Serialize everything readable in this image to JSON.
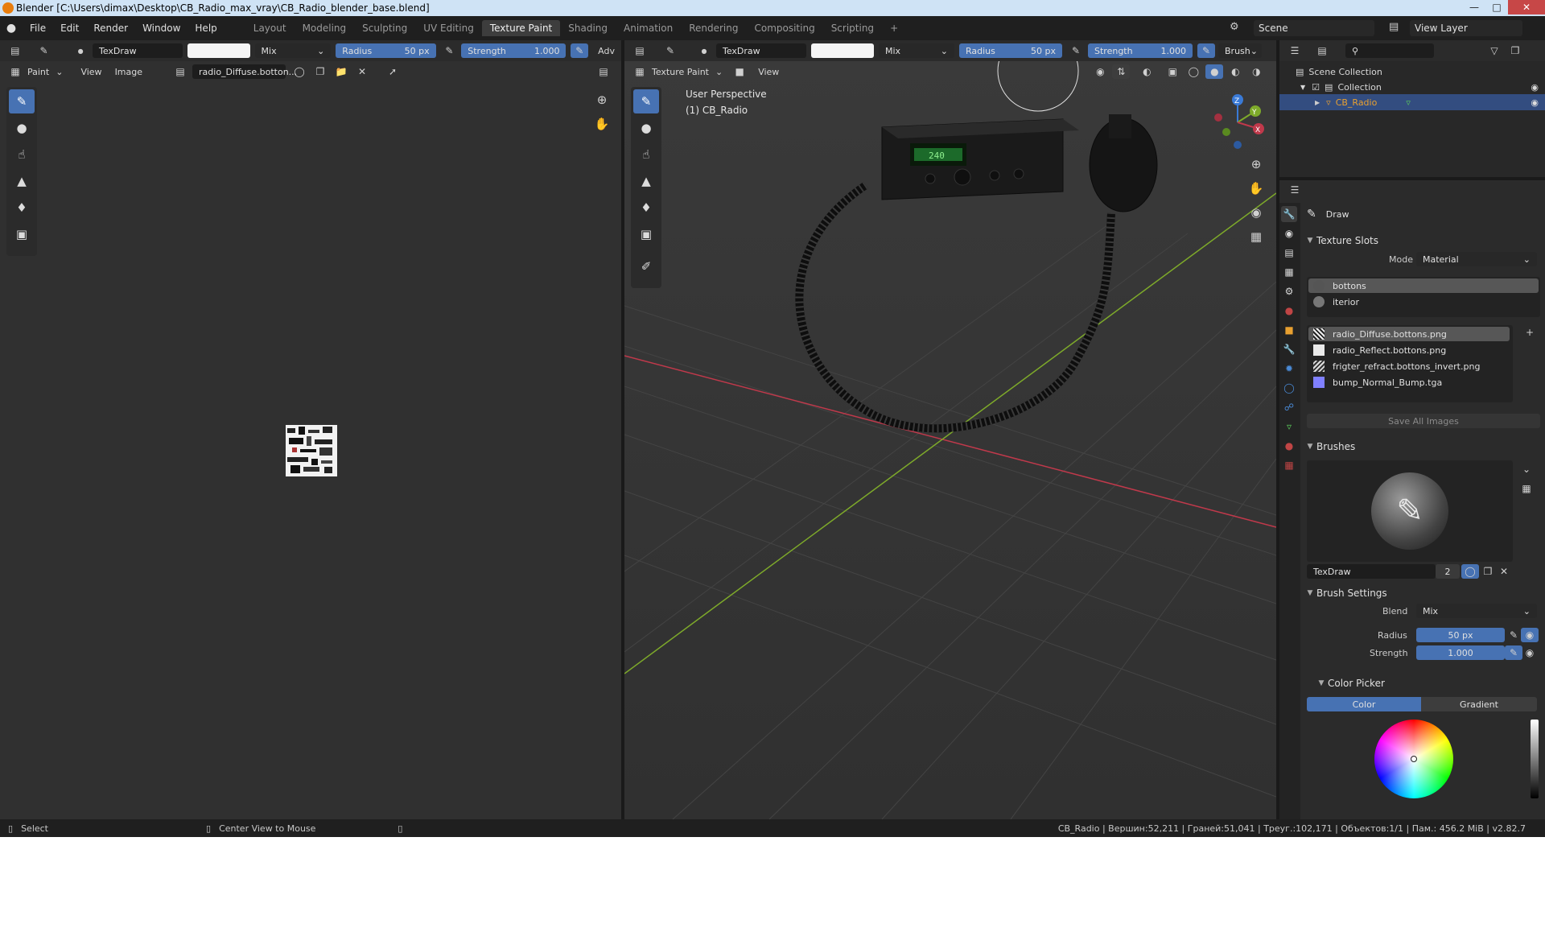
{
  "window": {
    "title": "Blender [C:\\Users\\dimax\\Desktop\\CB_Radio_max_vray\\CB_Radio_blender_base.blend]"
  },
  "menu": [
    "File",
    "Edit",
    "Render",
    "Window",
    "Help"
  ],
  "workspaces": [
    "Layout",
    "Modeling",
    "Sculpting",
    "UV Editing",
    "Texture Paint",
    "Shading",
    "Animation",
    "Rendering",
    "Compositing",
    "Scripting"
  ],
  "workspace_active": "Texture Paint",
  "scene": "Scene",
  "view_layer": "View Layer",
  "image_editor": {
    "brush_name": "TexDraw",
    "blend": "Mix",
    "radius_label": "Radius",
    "radius_value": "50 px",
    "strength_label": "Strength",
    "strength_value": "1.000",
    "adv": "Adv",
    "mode": "Paint",
    "menu_view": "View",
    "menu_image": "Image",
    "image_name": "radio_Diffuse.botton..."
  },
  "viewport": {
    "brush_name": "TexDraw",
    "blend": "Mix",
    "radius_label": "Radius",
    "radius_value": "50 px",
    "strength_label": "Strength",
    "strength_value": "1.000",
    "brush_menu": "Brush",
    "mode": "Texture Paint",
    "menu_view": "View",
    "perspective": "User Perspective",
    "object_label": "(1) CB_Radio",
    "gizmo": {
      "x": "X",
      "y": "Y",
      "z": "Z"
    },
    "radio_display": "240"
  },
  "outliner": {
    "scene_collection": "Scene Collection",
    "collection": "Collection",
    "object": "CB_Radio"
  },
  "properties": {
    "tool_name": "Draw",
    "texture_slots_title": "Texture Slots",
    "mode_label": "Mode",
    "mode_value": "Material",
    "materials": [
      "bottons",
      "iterior"
    ],
    "images": [
      "radio_Diffuse.bottons.png",
      "radio_Reflect.bottons.png",
      "frigter_refract.bottons_invert.png",
      "bump_Normal_Bump.tga"
    ],
    "save_all": "Save All Images",
    "brushes_title": "Brushes",
    "brush_name": "TexDraw",
    "brush_users": "2",
    "brush_settings_title": "Brush Settings",
    "blend_label": "Blend",
    "blend_value": "Mix",
    "radius_label": "Radius",
    "radius_value": "50 px",
    "strength_label": "Strength",
    "strength_value": "1.000",
    "color_picker_title": "Color Picker",
    "tab_color": "Color",
    "tab_gradient": "Gradient"
  },
  "status": {
    "select": "Select",
    "center_view": "Center View to Mouse",
    "stats": "CB_Radio | Вершин:52,211 | Граней:51,041 | Треуг.:102,171 | Объектов:1/1 | Пам.: 456.2 MiB | v2.82.7"
  },
  "colors": {
    "accent": "#4772b3",
    "selected_obj": "#e8a030",
    "x_axis": "#c0394b",
    "y_axis": "#7eaa2a",
    "z_axis": "#3a7ad6"
  }
}
